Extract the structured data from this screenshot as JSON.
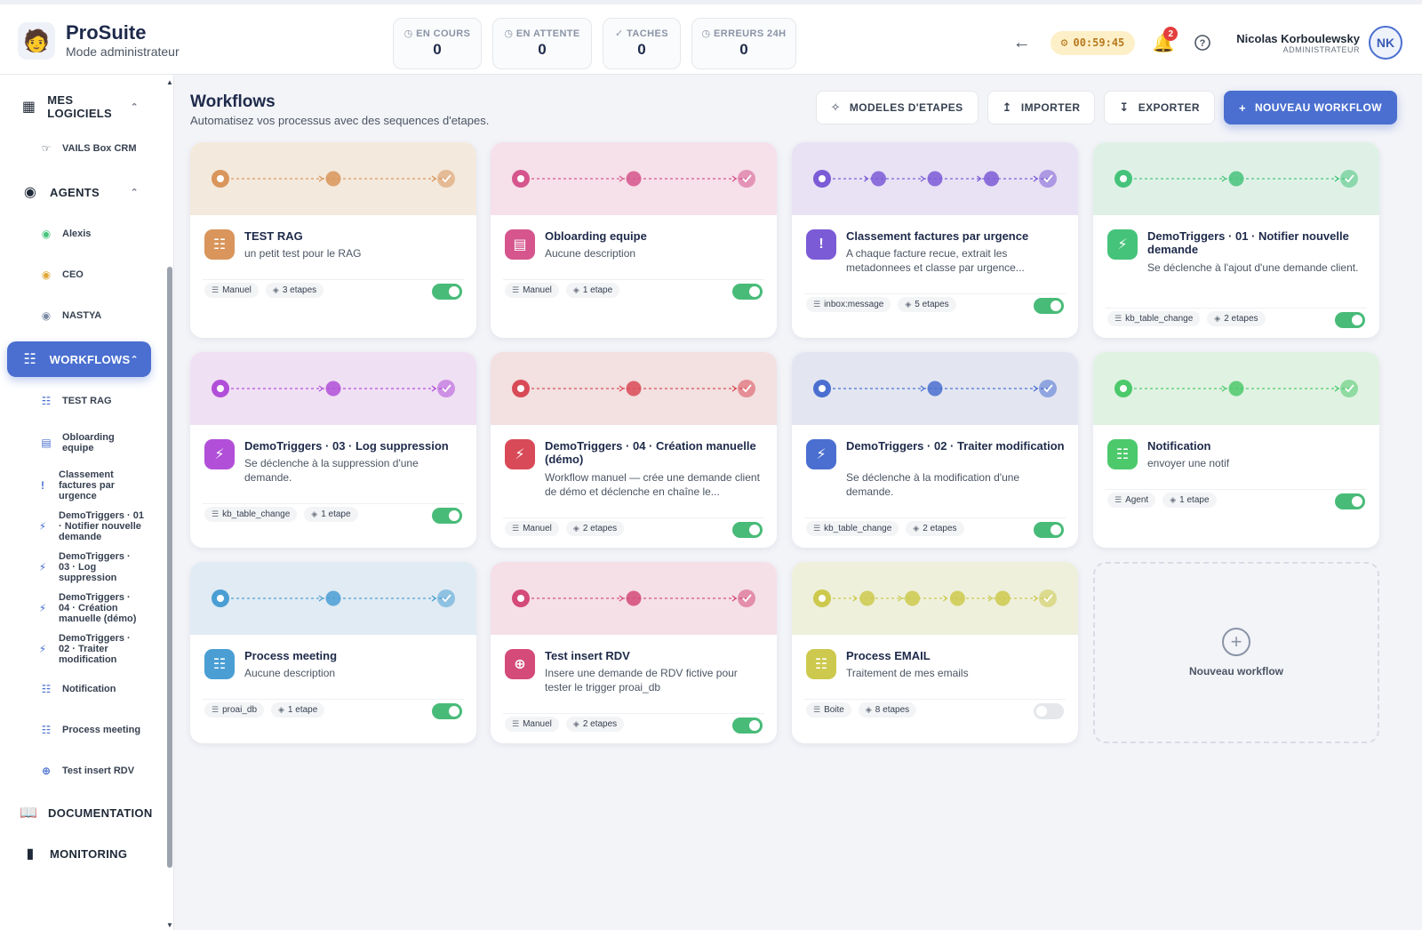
{
  "brand": {
    "name": "ProSuite",
    "subtitle": "Mode administrateur"
  },
  "stats": [
    {
      "label": "EN COURS",
      "value": "0"
    },
    {
      "label": "EN ATTENTE",
      "value": "0"
    },
    {
      "label": "TACHES",
      "value": "0"
    },
    {
      "label": "ERREURS 24H",
      "value": "0"
    }
  ],
  "header": {
    "timer": "00:59:45",
    "notifications": "2",
    "user_name": "Nicolas Korboulewsky",
    "user_role": "ADMINISTRATEUR",
    "initials": "NK"
  },
  "sidebar": {
    "mes_logiciels": "MES LOGICIELS",
    "vails": "VAILS Box CRM",
    "agents": "AGENTS",
    "agent_items": [
      "Alexis",
      "CEO",
      "NASTYA"
    ],
    "workflows": "WORKFLOWS",
    "workflow_items": [
      [
        "TEST RAG"
      ],
      [
        "Obloarding",
        "equipe"
      ],
      [
        "Classement",
        "factures par",
        "urgence"
      ],
      [
        "DemoTriggers · 01",
        "· Notifier nouvelle",
        "demande"
      ],
      [
        "DemoTriggers ·",
        "03 · Log",
        "suppression"
      ],
      [
        "DemoTriggers ·",
        "04 · Création",
        "manuelle (démo)"
      ],
      [
        "DemoTriggers ·",
        "02 · Traiter",
        "modification"
      ],
      [
        "Notification"
      ],
      [
        "Process meeting"
      ],
      [
        "Test insert RDV"
      ]
    ],
    "documentation": "DOCUMENTATION",
    "monitoring": "MONITORING"
  },
  "main": {
    "title": "Workflows",
    "subtitle": "Automatisez vos processus avec des sequences d'etapes.",
    "btn_models": "MODELES D'ETAPES",
    "btn_import": "IMPORTER",
    "btn_export": "EXPORTER",
    "btn_new": "NOUVEAU WORKFLOW",
    "new_card_label": "Nouveau workflow"
  },
  "colors": {
    "accent": "#4a6fd0",
    "toggle_on": "#48bb78"
  },
  "workflows": [
    {
      "title": "TEST RAG",
      "desc": "un petit test pour le RAG",
      "trigger": "Manuel",
      "steps": "3 etapes",
      "step_count": 3,
      "enabled": true,
      "color": "#d9955b",
      "band": "#f3e9dd",
      "icon": "workflow-icon"
    },
    {
      "title": "Obloarding equipe",
      "desc": "Aucune description",
      "trigger": "Manuel",
      "steps": "1 etape",
      "step_count": 3,
      "enabled": true,
      "color": "#d5558c",
      "band": "#f6e0ea",
      "icon": "book-icon"
    },
    {
      "title": "Classement factures par urgence",
      "desc": "A chaque facture recue, extrait les metadonnees et classe par urgence...",
      "trigger": "inbox:message",
      "steps": "5 etapes",
      "step_count": 5,
      "enabled": true,
      "color": "#7b5bd6",
      "band": "#e8e2f4",
      "icon": "exclamation-icon"
    },
    {
      "title": "DemoTriggers · 01 · Notifier nouvelle demande",
      "desc": "Se déclenche à l'ajout d'une demande client.",
      "trigger": "kb_table_change",
      "steps": "2 etapes",
      "step_count": 3,
      "enabled": true,
      "color": "#46c37b",
      "band": "#dff1e6",
      "icon": "bolt-icon"
    },
    {
      "title": "DemoTriggers · 03 · Log suppression",
      "desc": "Se déclenche à la suppression d'une demande.",
      "trigger": "kb_table_change",
      "steps": "1 etape",
      "step_count": 3,
      "enabled": true,
      "color": "#b14fd8",
      "band": "#f0e0f3",
      "icon": "bolt-icon"
    },
    {
      "title": "DemoTriggers · 04 · Création manuelle (démo)",
      "desc": "Workflow manuel — crée une demande client de démo et déclenche en chaîne le...",
      "trigger": "Manuel",
      "steps": "2 etapes",
      "step_count": 3,
      "enabled": true,
      "color": "#d84a57",
      "band": "#f3e0e0",
      "icon": "bolt-icon"
    },
    {
      "title": "DemoTriggers · 02 · Traiter modification",
      "desc": "Se déclenche à la modification d'une demande.",
      "trigger": "kb_table_change",
      "steps": "2 etapes",
      "step_count": 3,
      "enabled": true,
      "color": "#4a6fd0",
      "band": "#e3e6f1",
      "icon": "bolt-icon"
    },
    {
      "title": "Notification",
      "desc": "envoyer une notif",
      "trigger": "Agent",
      "steps": "1 etape",
      "step_count": 3,
      "enabled": true,
      "color": "#4cc96b",
      "band": "#e0f2e2",
      "icon": "workflow-icon"
    },
    {
      "title": "Process meeting",
      "desc": "Aucune description",
      "trigger": "proai_db",
      "steps": "1 etape",
      "step_count": 3,
      "enabled": true,
      "color": "#4a9ed4",
      "band": "#e1ebf3",
      "icon": "workflow-icon"
    },
    {
      "title": "Test insert RDV",
      "desc": "Insere une demande de RDV fictive pour tester le trigger proai_db",
      "trigger": "Manuel",
      "steps": "2 etapes",
      "step_count": 3,
      "enabled": true,
      "color": "#d44a78",
      "band": "#f5e0e7",
      "icon": "plus-circle-icon"
    },
    {
      "title": "Process EMAIL",
      "desc": "Traitement de mes emails",
      "trigger": "Boite",
      "steps": "8 etapes",
      "step_count": 6,
      "enabled": false,
      "color": "#cdc94e",
      "band": "#eef0dc",
      "icon": "workflow-icon"
    }
  ]
}
